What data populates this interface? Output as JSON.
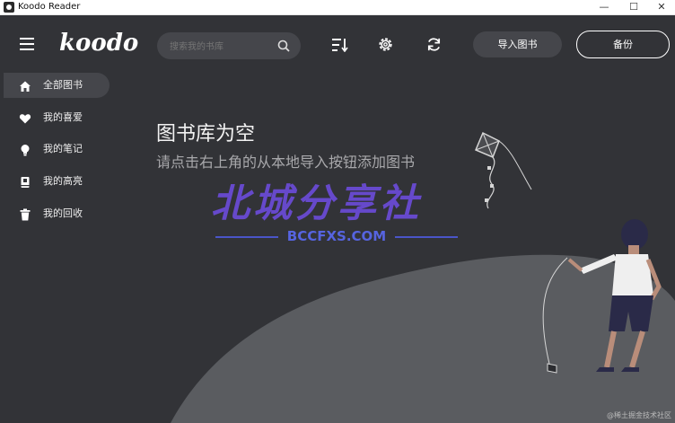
{
  "window": {
    "title": "Koodo Reader",
    "controls": {
      "minimize": "—",
      "maximize": "☐",
      "close": "✕"
    }
  },
  "header": {
    "logo_text": "koodo",
    "search": {
      "placeholder": "搜索我的书库"
    },
    "import_label": "导入图书",
    "backup_label": "备份"
  },
  "sidebar": {
    "items": [
      {
        "label": "全部图书",
        "icon": "home-icon",
        "active": true
      },
      {
        "label": "我的喜爱",
        "icon": "heart-icon",
        "active": false
      },
      {
        "label": "我的笔记",
        "icon": "lightbulb-icon",
        "active": false
      },
      {
        "label": "我的高亮",
        "icon": "book-highlight-icon",
        "active": false
      },
      {
        "label": "我的回收",
        "icon": "trash-icon",
        "active": false
      }
    ]
  },
  "main": {
    "empty_title": "图书库为空",
    "empty_subtitle": "请点击右上角的从本地导入按钮添加图书"
  },
  "watermark": {
    "text": "北城分享社",
    "url": "BCCFXS.COM",
    "corner": "@稀土掘金技术社区"
  },
  "colors": {
    "background": "#323337",
    "hill": "#5a5c60",
    "active_item": "#45464b",
    "watermark": "#6b4bd8"
  }
}
